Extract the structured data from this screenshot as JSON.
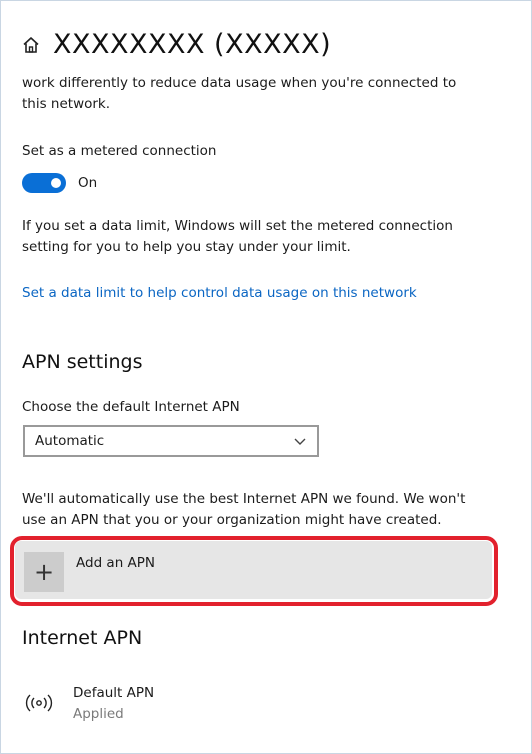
{
  "header": {
    "title": "XXXXXXXX (XXXXX)",
    "home_icon": "home-icon"
  },
  "metered": {
    "intro_line1": "work differently to reduce data usage when you're connected to",
    "intro_line2": "this network.",
    "toggle_label": "Set as a metered connection",
    "toggle_state": "On",
    "toggle_on": true,
    "accent_color": "#0a6fd6",
    "limit_line1": "If you set a data limit, Windows will set the metered connection",
    "limit_line2": "setting for you to help you stay under your limit.",
    "limit_link": "Set a data limit to help control data usage on this network",
    "link_color": "#0b66c3"
  },
  "apn_settings": {
    "heading": "APN settings",
    "select_label": "Choose the default Internet APN",
    "select_value": "Automatic",
    "note_line1": "We'll automatically use the best Internet APN we found. We won't",
    "note_line2": "use an APN that you or your organization might have created.",
    "add_button_label": "Add an APN",
    "add_button_icon": "plus-icon",
    "highlight_color": "#e2212d"
  },
  "internet_apn": {
    "heading": "Internet APN",
    "items": [
      {
        "name": "Default APN",
        "status": "Applied",
        "icon": "cellular-signal-icon"
      }
    ]
  }
}
